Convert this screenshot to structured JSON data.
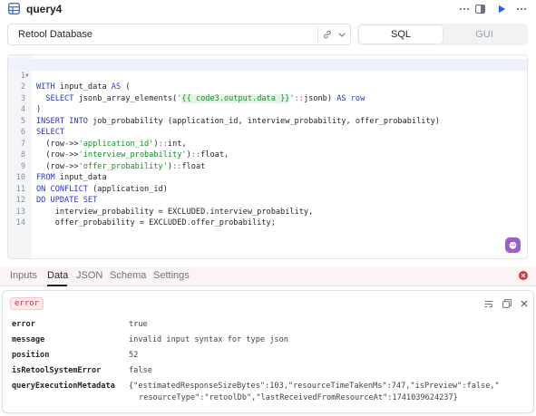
{
  "header": {
    "title": "query4",
    "icons": [
      "table-icon",
      "more-icon",
      "collapse-icon",
      "run-icon",
      "options-icon"
    ]
  },
  "resource": {
    "name": "Retool Database",
    "icons": [
      "link-icon",
      "chevron-down-icon"
    ]
  },
  "mode_toggle": {
    "options": [
      "SQL",
      "GUI"
    ],
    "selected": "SQL"
  },
  "editor": {
    "lines": [
      {
        "n": "1",
        "fold": true,
        "active": true
      },
      {
        "n": "2"
      },
      {
        "n": "3"
      },
      {
        "n": "4"
      },
      {
        "n": "5"
      },
      {
        "n": "6"
      },
      {
        "n": "7"
      },
      {
        "n": "8"
      },
      {
        "n": "9"
      },
      {
        "n": "10"
      },
      {
        "n": "11"
      },
      {
        "n": "12"
      },
      {
        "n": "13"
      },
      {
        "n": "14"
      }
    ],
    "code": {
      "l1_kw1": "WITH",
      "l1_t1": " input_data ",
      "l1_kw2": "AS",
      "l1_t2": " (",
      "l2_kw1": "SELECT",
      "l2_t1": " jsonb_array_elements(",
      "l2_q1": "'",
      "l2_tmpl": "{{ code3.output.data }}",
      "l2_q2": "'",
      "l2_op": "::",
      "l2_t2": "jsonb) ",
      "l2_kw2": "AS",
      "l2_t3": " ",
      "l2_kw3": "row",
      "l3": ")",
      "l4_kw1": "INSERT INTO",
      "l4_t1": " job_probability (application_id, interview_probability, offer_probability)",
      "l5_kw1": "SELECT",
      "l6_t1": "(row->>",
      "l6_str": "'application_id'",
      "l6_t2": ")",
      "l6_op": "::",
      "l6_t3": "int,",
      "l7_t1": "(row->>",
      "l7_str": "'interview_probability'",
      "l7_t2": ")",
      "l7_op": "::",
      "l7_t3": "float,",
      "l8_t1": "(row->>",
      "l8_str": "'offer_probability'",
      "l8_t2": ")",
      "l8_op": "::",
      "l8_t3": "float",
      "l9_kw1": "FROM",
      "l9_t1": " input_data",
      "l10_kw1": "ON CONFLICT",
      "l10_t1": " (application_id)",
      "l11_kw1": "DO UPDATE SET",
      "l12_t1": "interview_probability = EXCLUDED.interview_probability,",
      "l13_t1": "offer_probability = EXCLUDED.offer_probability;"
    }
  },
  "tabs": {
    "items": [
      "Inputs",
      "Data",
      "JSON",
      "Schema",
      "Settings"
    ],
    "active": "Data"
  },
  "error_panel": {
    "badge": "error",
    "rows": [
      {
        "key": "error",
        "value": "true"
      },
      {
        "key": "message",
        "value": "invalid input syntax for type json"
      },
      {
        "key": "position",
        "value": "52"
      },
      {
        "key": "isRetoolSystemError",
        "value": "false"
      },
      {
        "key": "queryExecutionMetadata",
        "value": "{\"estimatedResponseSizeBytes\":103,\"resourceTimeTakenMs\":747,\"isPreview\":false,\""
      },
      {
        "key": "",
        "value": "resourceType\":\"retoolDb\",\"lastReceivedFromResourceAt\":1741039624237}"
      }
    ]
  },
  "colors": {
    "keyword": "#2b36c5",
    "string": "#1a8a2e",
    "run": "#2563eb",
    "error": "#d9333f",
    "assistant": "#9b5ecb"
  }
}
